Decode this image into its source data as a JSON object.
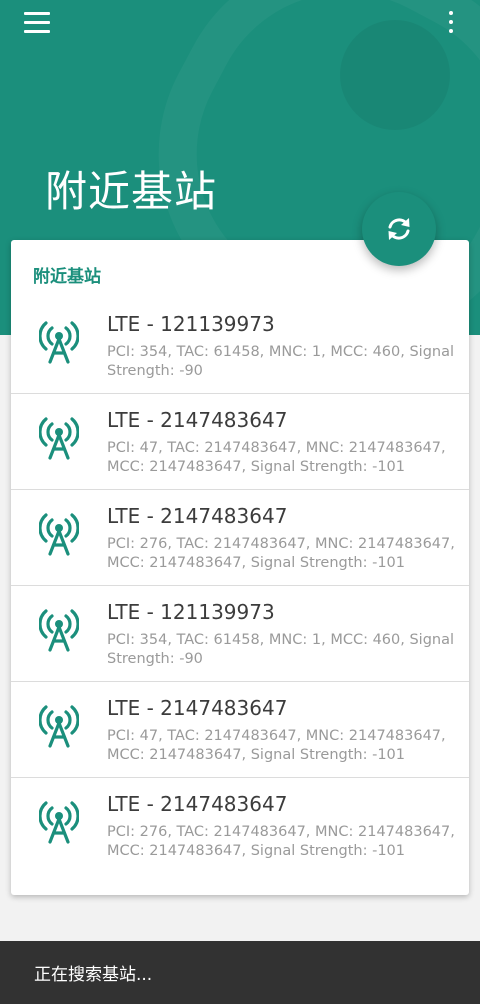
{
  "header": {
    "title": "附近基站"
  },
  "card": {
    "title": "附近基站"
  },
  "cells": [
    {
      "name": "LTE - 121139973",
      "detail": "PCI: 354, TAC: 61458, MNC: 1, MCC: 460, Signal Strength: -90"
    },
    {
      "name": "LTE - 2147483647",
      "detail": "PCI: 47, TAC: 2147483647, MNC: 2147483647, MCC: 2147483647, Signal Strength: -101"
    },
    {
      "name": "LTE - 2147483647",
      "detail": "PCI: 276, TAC: 2147483647, MNC: 2147483647, MCC: 2147483647, Signal Strength: -101"
    },
    {
      "name": "LTE - 121139973",
      "detail": "PCI: 354, TAC: 61458, MNC: 1, MCC: 460, Signal Strength: -90"
    },
    {
      "name": "LTE - 2147483647",
      "detail": "PCI: 47, TAC: 2147483647, MNC: 2147483647, MCC: 2147483647, Signal Strength: -101"
    },
    {
      "name": "LTE - 2147483647",
      "detail": "PCI: 276, TAC: 2147483647, MNC: 2147483647, MCC: 2147483647, Signal Strength: -101"
    }
  ],
  "snackbar": {
    "text": "正在搜索基站..."
  },
  "icons": {
    "menu": "menu-icon",
    "more": "more-vert-icon",
    "refresh": "refresh-icon",
    "cell": "cell-tower-icon"
  },
  "colors": {
    "accent": "#1b8f7c",
    "snackbar": "#323232"
  }
}
